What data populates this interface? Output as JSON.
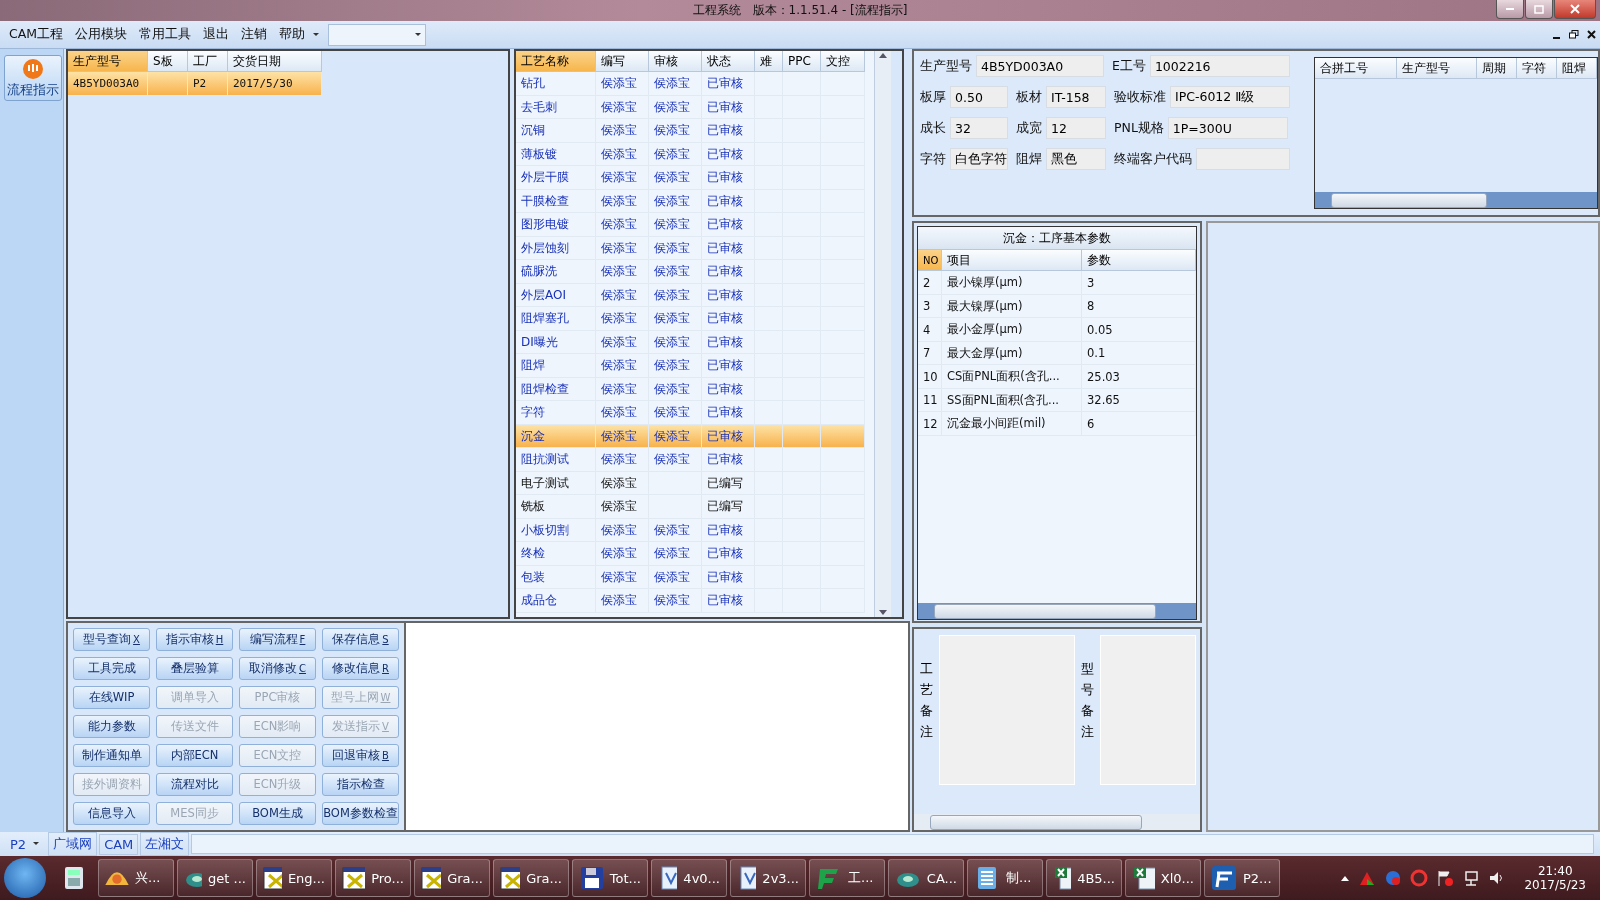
{
  "window": {
    "title": "工程系统　版本：1.1.51.4 - [流程指示]"
  },
  "menu": [
    "CAM工程",
    "公用模块",
    "常用工具",
    "退出",
    "注销",
    "帮助"
  ],
  "sidebar": {
    "button": "流程指示"
  },
  "orders": {
    "columns": [
      "生产型号",
      "S板",
      "工厂",
      "交货日期"
    ],
    "rows": [
      {
        "cells": [
          "4B5YD003A0",
          "",
          "P2",
          "2017/5/30"
        ],
        "selected": true
      }
    ]
  },
  "processes": {
    "columns": [
      "工艺名称",
      "编写",
      "审核",
      "状态",
      "难",
      "PPC",
      "文控"
    ],
    "rows": [
      {
        "cells": [
          "钻孔",
          "侯添宝",
          "侯添宝",
          "已审核"
        ],
        "reviewed": true,
        "selected": false
      },
      {
        "cells": [
          "去毛刺",
          "侯添宝",
          "侯添宝",
          "已审核"
        ],
        "reviewed": true,
        "selected": false
      },
      {
        "cells": [
          "沉铜",
          "侯添宝",
          "侯添宝",
          "已审核"
        ],
        "reviewed": true,
        "selected": false
      },
      {
        "cells": [
          "薄板镀",
          "侯添宝",
          "侯添宝",
          "已审核"
        ],
        "reviewed": true,
        "selected": false
      },
      {
        "cells": [
          "外层干膜",
          "侯添宝",
          "侯添宝",
          "已审核"
        ],
        "reviewed": true,
        "selected": false
      },
      {
        "cells": [
          "干膜检查",
          "侯添宝",
          "侯添宝",
          "已审核"
        ],
        "reviewed": true,
        "selected": false
      },
      {
        "cells": [
          "图形电镀",
          "侯添宝",
          "侯添宝",
          "已审核"
        ],
        "reviewed": true,
        "selected": false
      },
      {
        "cells": [
          "外层蚀刻",
          "侯添宝",
          "侯添宝",
          "已审核"
        ],
        "reviewed": true,
        "selected": false
      },
      {
        "cells": [
          "硫脲洗",
          "侯添宝",
          "侯添宝",
          "已审核"
        ],
        "reviewed": true,
        "selected": false
      },
      {
        "cells": [
          "外层AOI",
          "侯添宝",
          "侯添宝",
          "已审核"
        ],
        "reviewed": true,
        "selected": false
      },
      {
        "cells": [
          "阻焊塞孔",
          "侯添宝",
          "侯添宝",
          "已审核"
        ],
        "reviewed": true,
        "selected": false
      },
      {
        "cells": [
          "DI曝光",
          "侯添宝",
          "侯添宝",
          "已审核"
        ],
        "reviewed": true,
        "selected": false
      },
      {
        "cells": [
          "阻焊",
          "侯添宝",
          "侯添宝",
          "已审核"
        ],
        "reviewed": true,
        "selected": false
      },
      {
        "cells": [
          "阻焊检查",
          "侯添宝",
          "侯添宝",
          "已审核"
        ],
        "reviewed": true,
        "selected": false
      },
      {
        "cells": [
          "字符",
          "侯添宝",
          "侯添宝",
          "已审核"
        ],
        "reviewed": true,
        "selected": false
      },
      {
        "cells": [
          "沉金",
          "侯添宝",
          "侯添宝",
          "已审核"
        ],
        "reviewed": true,
        "selected": true
      },
      {
        "cells": [
          "阻抗测试",
          "侯添宝",
          "侯添宝",
          "已审核"
        ],
        "reviewed": true,
        "selected": false
      },
      {
        "cells": [
          "电子测试",
          "侯添宝",
          "",
          "已编写"
        ],
        "reviewed": false,
        "selected": false
      },
      {
        "cells": [
          "铣板",
          "侯添宝",
          "",
          "已编写"
        ],
        "reviewed": false,
        "selected": false
      },
      {
        "cells": [
          "小板切割",
          "侯添宝",
          "侯添宝",
          "已审核"
        ],
        "reviewed": true,
        "selected": false
      },
      {
        "cells": [
          "终检",
          "侯添宝",
          "侯添宝",
          "已审核"
        ],
        "reviewed": true,
        "selected": false
      },
      {
        "cells": [
          "包装",
          "侯添宝",
          "侯添宝",
          "已审核"
        ],
        "reviewed": true,
        "selected": false
      },
      {
        "cells": [
          "成品仓",
          "侯添宝",
          "侯添宝",
          "已审核"
        ],
        "reviewed": true,
        "selected": false
      }
    ]
  },
  "buttons": [
    {
      "label": "型号查询",
      "hotkey": "X",
      "disabled": false
    },
    {
      "label": "指示审核",
      "hotkey": "H",
      "disabled": false
    },
    {
      "label": "编写流程",
      "hotkey": "F",
      "disabled": false
    },
    {
      "label": "保存信息",
      "hotkey": "S",
      "disabled": false
    },
    {
      "label": "工具完成",
      "disabled": false
    },
    {
      "label": "叠层验算",
      "disabled": false
    },
    {
      "label": "取消修改",
      "hotkey": "C",
      "disabled": false
    },
    {
      "label": "修改信息",
      "hotkey": "R",
      "disabled": false
    },
    {
      "label": "在线WIP",
      "disabled": false
    },
    {
      "label": "调单导入",
      "disabled": true
    },
    {
      "label": "PPC审核",
      "disabled": true
    },
    {
      "label": "型号上网",
      "hotkey": "W",
      "disabled": true
    },
    {
      "label": "能力参数",
      "disabled": false
    },
    {
      "label": "传送文件",
      "disabled": true
    },
    {
      "label": "ECN影响",
      "disabled": true
    },
    {
      "label": "发送指示",
      "hotkey": "V",
      "disabled": true
    },
    {
      "label": "制作通知单",
      "disabled": false
    },
    {
      "label": "内部ECN",
      "disabled": false
    },
    {
      "label": "ECN文控",
      "disabled": true
    },
    {
      "label": "回退审核",
      "hotkey": "B",
      "disabled": false
    },
    {
      "label": "接外调资料",
      "disabled": true
    },
    {
      "label": "流程对比",
      "disabled": false
    },
    {
      "label": "ECN升级",
      "disabled": true
    },
    {
      "label": "指示检查",
      "disabled": false
    },
    {
      "label": "信息导入",
      "disabled": false
    },
    {
      "label": "MES同步",
      "disabled": true
    },
    {
      "label": "BOM生成",
      "disabled": false
    },
    {
      "label": "BOM参数检查",
      "disabled": false
    }
  ],
  "info": [
    [
      {
        "label": "生产型号",
        "value": "4B5YD003A0"
      },
      {
        "label": "E工号",
        "value": "1002216"
      }
    ],
    [
      {
        "label": "板厚",
        "value": "0.50"
      },
      {
        "label": "板材",
        "value": "IT-158"
      },
      {
        "label": "验收标准",
        "value": "IPC-6012 Ⅱ级"
      }
    ],
    [
      {
        "label": "成长",
        "value": "32"
      },
      {
        "label": "成宽",
        "value": "12"
      },
      {
        "label": "PNL规格",
        "value": "1P=300U"
      }
    ],
    [
      {
        "label": "字符",
        "value": "白色字符"
      },
      {
        "label": "阻焊",
        "value": "黑色"
      },
      {
        "label": "终端客户代码"
      }
    ]
  ],
  "merge_grid": {
    "columns": [
      "合拼工号",
      "生产型号",
      "周期",
      "字符",
      "阻焊"
    ]
  },
  "params": {
    "title": "沉金：工序基本参数",
    "columns": [
      "NO",
      "项目",
      "参数"
    ],
    "rows": [
      [
        "2",
        "最小镍厚(μm)",
        "3"
      ],
      [
        "3",
        "最大镍厚(μm)",
        "8"
      ],
      [
        "4",
        "最小金厚(μm)",
        "0.05"
      ],
      [
        "7",
        "最大金厚(μm)",
        "0.1"
      ],
      [
        "10",
        "CS面PNL面积(含孔...",
        "25.03"
      ],
      [
        "11",
        "SS面PNL面积(含孔...",
        "32.65"
      ],
      [
        "12",
        "沉金最小间距(mil)",
        "6"
      ]
    ]
  },
  "remarks": [
    {
      "label": "工艺备注"
    },
    {
      "label": "型号备注"
    }
  ],
  "status_bar": {
    "factory": "P2",
    "items": [
      "广域网",
      "CAM",
      "左湘文"
    ]
  },
  "taskbar": {
    "items": [
      {
        "kind": "calculator"
      },
      {
        "kind": "shell",
        "label": "兴..."
      },
      {
        "kind": "disc",
        "label": "get ..."
      },
      {
        "kind": "xwin",
        "label": "Eng..."
      },
      {
        "kind": "xwin",
        "label": "Pro..."
      },
      {
        "kind": "xwin",
        "label": "Gra..."
      },
      {
        "kind": "xwin",
        "label": "Gra..."
      },
      {
        "kind": "floppy",
        "label": "Tot..."
      },
      {
        "kind": "doc",
        "label": "4v0..."
      },
      {
        "kind": "doc",
        "label": "2v3..."
      },
      {
        "kind": "fp",
        "label": "工..."
      },
      {
        "kind": "disc",
        "label": "CA..."
      },
      {
        "kind": "list",
        "label": "制..."
      },
      {
        "kind": "excel",
        "label": "4B5..."
      },
      {
        "kind": "excel",
        "label": "Xl0..."
      },
      {
        "kind": "fapp",
        "label": "P2..."
      }
    ],
    "time": "21:40",
    "date": "2017/5/23"
  }
}
